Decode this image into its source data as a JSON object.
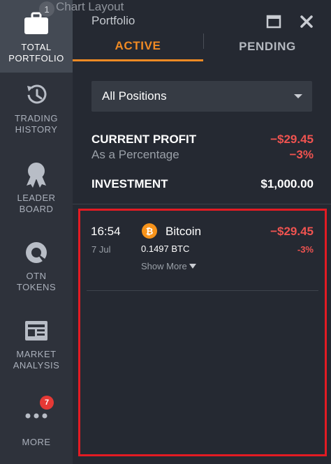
{
  "ghost": {
    "number": "1",
    "chart_layout": "Chart Layout"
  },
  "panel": {
    "title": "Portfolio"
  },
  "sidebar": {
    "items": [
      {
        "label": "TOTAL\nPORTFOLIO",
        "icon": "briefcase-icon",
        "active": true
      },
      {
        "label": "TRADING\nHISTORY",
        "icon": "history-icon"
      },
      {
        "label": "LEADER\nBOARD",
        "icon": "award-icon"
      },
      {
        "label": "OTN\nTOKENS",
        "icon": "token-icon"
      },
      {
        "label": "MARKET\nANALYSIS",
        "icon": "newspaper-icon"
      },
      {
        "label": "MORE",
        "icon": "more-dots-icon",
        "badge": "7"
      }
    ]
  },
  "tabs": {
    "active": "ACTIVE",
    "pending": "PENDING"
  },
  "filter": {
    "selected": "All Positions"
  },
  "summary": {
    "current_profit_label": "CURRENT PROFIT",
    "current_profit_value": "−$29.45",
    "percentage_label": "As a Percentage",
    "percentage_value": "−3%",
    "investment_label": "INVESTMENT",
    "investment_value": "$1,000.00"
  },
  "positions": [
    {
      "time": "16:54",
      "date": "7 Jul",
      "coin_symbol": "₿",
      "asset": "Bitcoin",
      "amount": "0.1497 BTC",
      "show_more": "Show More",
      "profit": "−$29.45",
      "percent": "-3%"
    }
  ],
  "colors": {
    "accent": "#f08a24",
    "negative": "#ef5350",
    "highlight": "#e31b23",
    "bitcoin": "#f7931a"
  }
}
